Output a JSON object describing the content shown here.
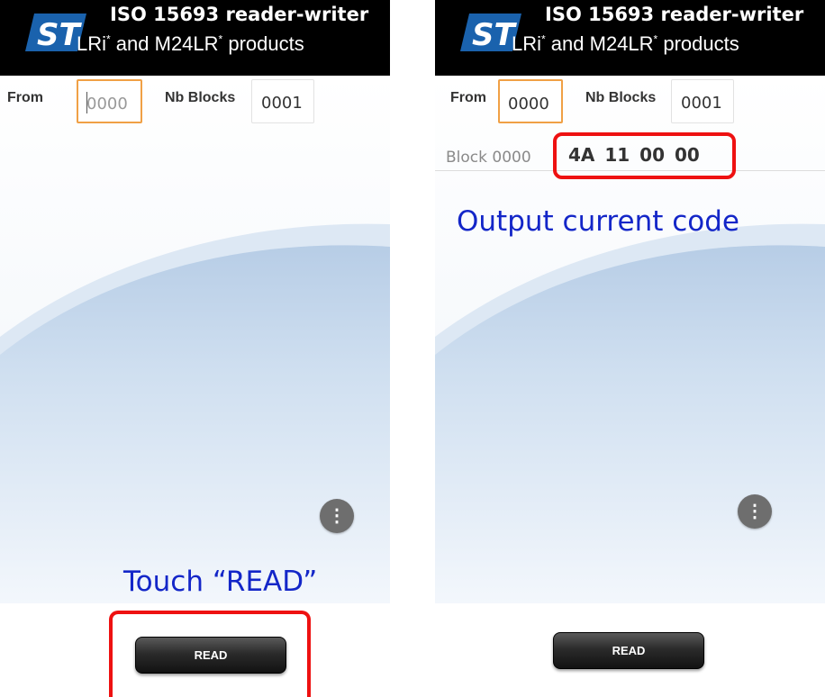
{
  "app": {
    "title_line1": "ISO 15693 reader-writer",
    "title_line2_a": "LRi",
    "title_line2_b": " and M24LR",
    "title_line2_c": " products",
    "title_sup": "*",
    "logo_text": "ST"
  },
  "left_screen": {
    "from_label": "From",
    "from_placeholder": "0000",
    "nb_blocks_label": "Nb Blocks",
    "nb_blocks_value": "0001",
    "menu_icon": "⋮",
    "read_button_label": "READ",
    "annotation": "Touch “READ”"
  },
  "right_screen": {
    "from_label": "From",
    "from_value": "0000",
    "nb_blocks_label": "Nb Blocks",
    "nb_blocks_value": "0001",
    "block_label": "Block 0000",
    "block_value": "4A  11  00  00",
    "menu_icon": "⋮",
    "read_button_label": "READ",
    "annotation": "Output current code"
  },
  "colors": {
    "header_bg": "#000000",
    "focus_border": "#f0a045",
    "annotation_text": "#1326c8",
    "highlight_box": "#ee1111",
    "logo_blue": "#1a62ad"
  },
  "icons": [
    "st-logo-icon",
    "overflow-menu-icon"
  ]
}
